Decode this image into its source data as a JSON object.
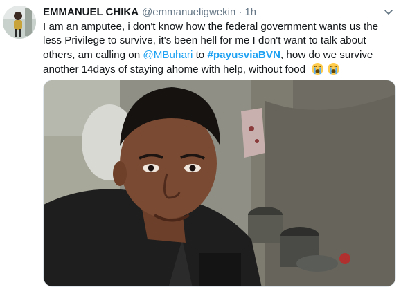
{
  "tweet": {
    "display_name": "EMMANUEL CHIKA",
    "handle": "@emmanueligwekin",
    "separator": "·",
    "time": "1h",
    "text": {
      "part1": "I am an amputee, i don't know how the federal government wants us the less Privilege to survive, it's been hell for me I don't want to talk about others, am calling on ",
      "mention": "@MBuhari",
      "part2": " to ",
      "hashtag": "#payusviaBVN",
      "part3": ", how do we survive another 14days of staying ahome with help, without food "
    },
    "emojis": [
      "loudly-crying-face",
      "loudly-crying-face"
    ]
  },
  "icons": {
    "caret": "chevron-down-icon",
    "avatar": "user-avatar"
  },
  "colors": {
    "link": "#1da1f2",
    "secondary_text": "#657786",
    "primary_text": "#14171a"
  }
}
